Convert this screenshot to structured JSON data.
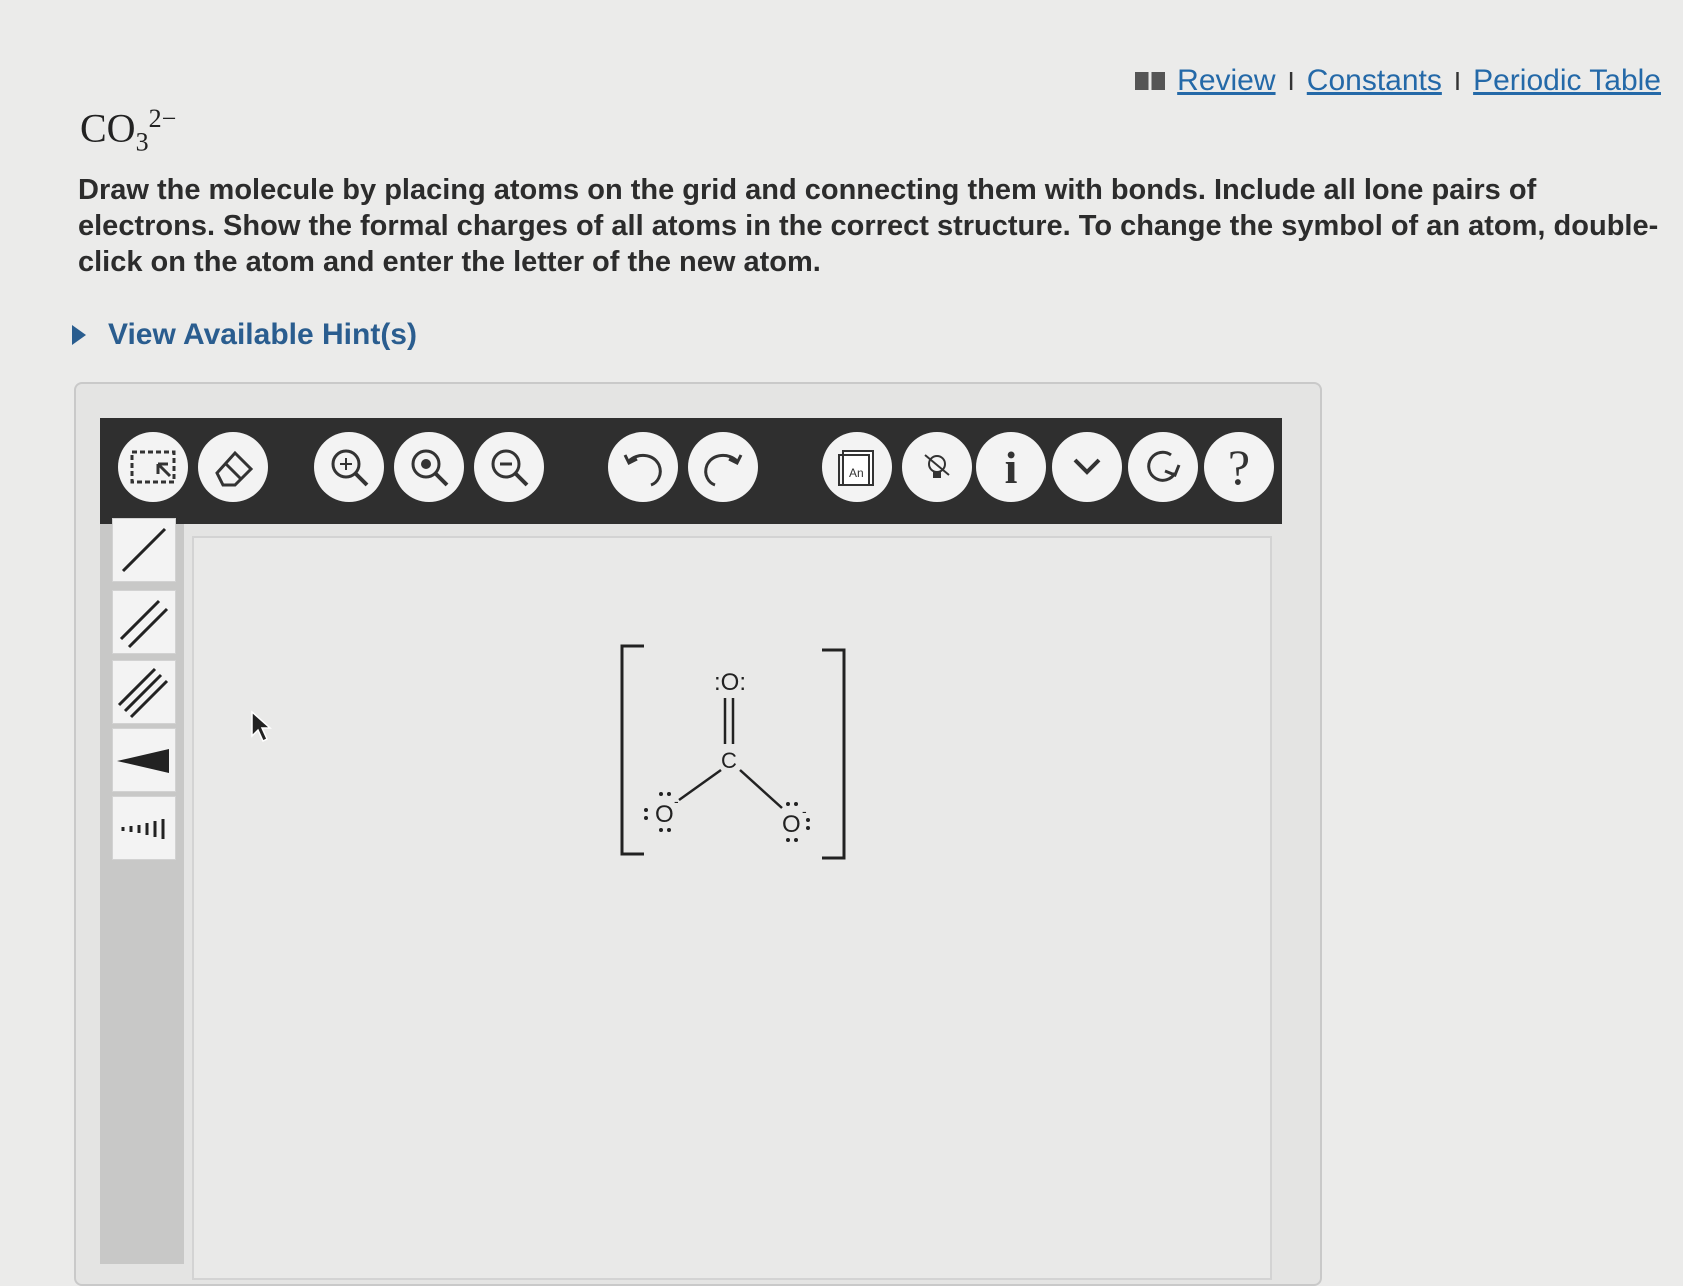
{
  "links": {
    "review": "Review",
    "separator": "I",
    "constants": "Constants",
    "periodic_table": "Periodic Table"
  },
  "formula": {
    "base": "CO",
    "subscript": "3",
    "charge": "2−"
  },
  "instructions": "Draw the molecule by placing atoms on the grid and connecting them with bonds. Include all lone pairs of electrons. Show the formal charges of all atoms in the correct structure. To change the symbol of an atom, double-click on the atom and enter the letter of the new atom.",
  "hints_label": "View Available Hint(s)",
  "toolbar": {
    "buttons": [
      {
        "name": "select-tool-icon"
      },
      {
        "name": "eraser-icon"
      },
      {
        "name": "zoom-in-icon"
      },
      {
        "name": "zoom-fit-icon"
      },
      {
        "name": "zoom-out-icon"
      },
      {
        "name": "undo-icon"
      },
      {
        "name": "redo-icon"
      },
      {
        "name": "template-icon",
        "label": "An"
      },
      {
        "name": "lightbulb-icon"
      },
      {
        "name": "info-icon",
        "label": "i"
      },
      {
        "name": "chevron-down-icon"
      },
      {
        "name": "reset-icon"
      },
      {
        "name": "help-icon",
        "label": "?"
      }
    ]
  },
  "sidebar_tools": [
    "single-bond-icon",
    "double-bond-icon",
    "triple-bond-icon",
    "wedge-bond-icon",
    "hash-bond-icon"
  ],
  "molecule": {
    "atoms": [
      {
        "symbol": "O",
        "display": ":O:",
        "role": "top"
      },
      {
        "symbol": "C",
        "display": "C",
        "role": "center"
      },
      {
        "symbol": "O",
        "display": "O",
        "role": "left",
        "charge": "-"
      },
      {
        "symbol": "O",
        "display": "O",
        "role": "right",
        "charge": "-"
      }
    ]
  },
  "colors": {
    "link": "#2469a8",
    "toolbar_bg": "#2f2f2f",
    "hint": "#2a5d8f"
  }
}
